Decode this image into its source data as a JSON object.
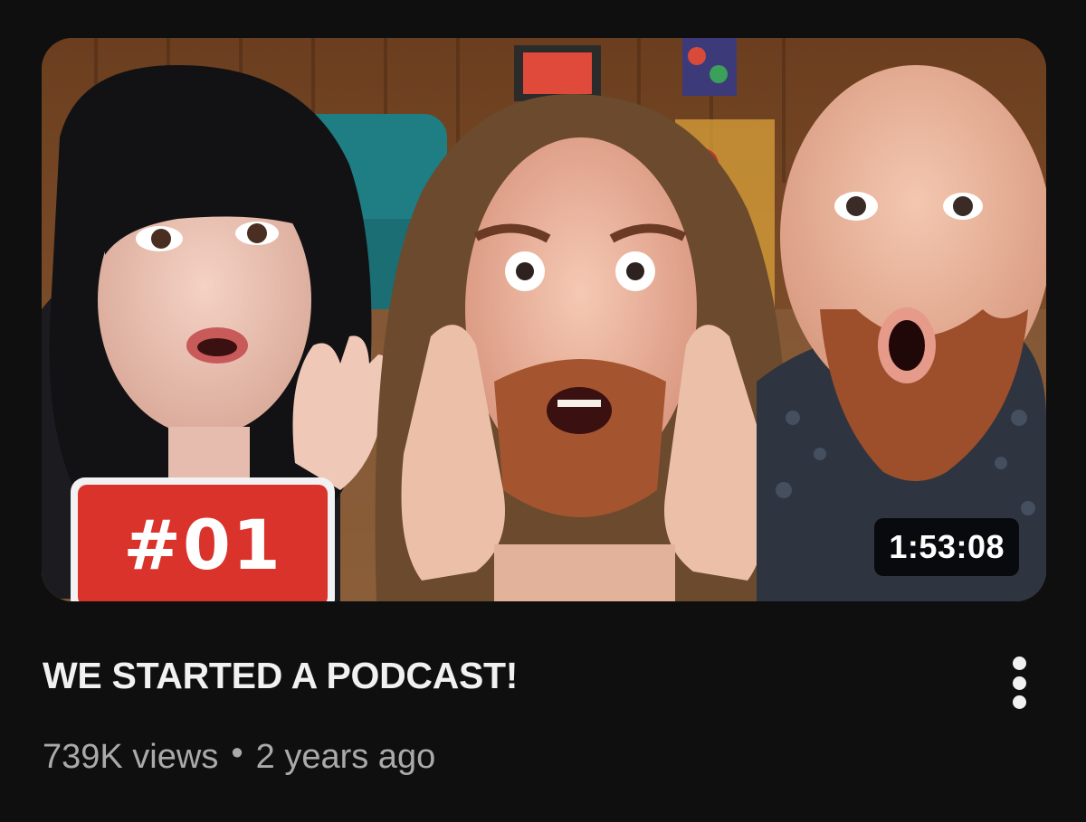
{
  "video": {
    "title": "WE STARTED A PODCAST!",
    "views": "739K views",
    "separator": "•",
    "age": "2 years ago",
    "duration": "1:53:08",
    "thumbnail_badge": "#01",
    "thumbnail_description": "Three people with shocked faces in a wood-paneled podcast studio"
  },
  "icons": {
    "more": "vertical-ellipsis-icon"
  },
  "colors": {
    "background": "#0f0f0f",
    "title_text": "#f1f1f1",
    "meta_text": "#aaaaaa",
    "badge_red": "#d9332b"
  }
}
